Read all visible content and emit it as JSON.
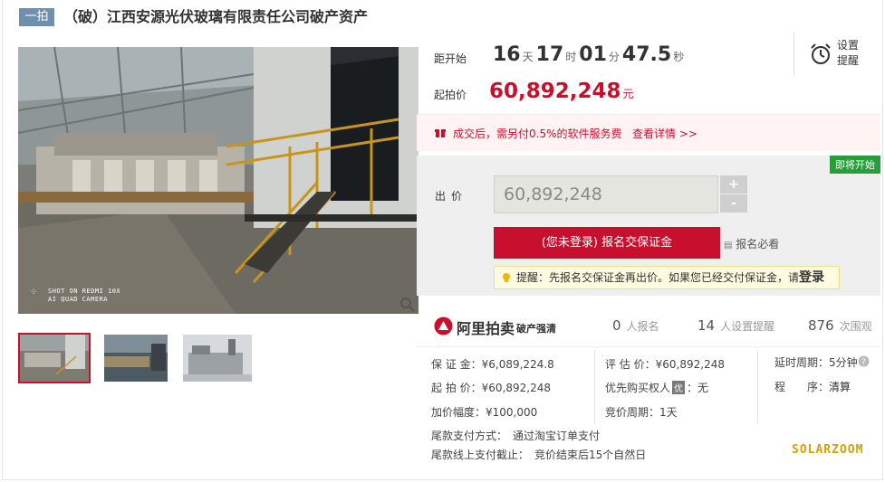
{
  "header": {
    "round_tag": "一拍",
    "title": "（破）江西安源光伏玻璃有限责任公司破产资产"
  },
  "gallery": {
    "camera_watermark_line1": "SHOT ON REDMI 10X",
    "camera_watermark_line2": "AI QUAD CAMERA",
    "zoom_icon": "magnifier-icon",
    "thumbnails": [
      "thumb-1",
      "thumb-2",
      "thumb-3"
    ]
  },
  "countdown": {
    "label": "距开始",
    "days": "16",
    "days_unit": "天",
    "hours": "17",
    "hours_unit": "时",
    "minutes": "01",
    "minutes_unit": "分",
    "seconds": "47.5",
    "seconds_unit": "秒"
  },
  "remind": {
    "label": "设置提醒",
    "icon": "alarm-clock-icon"
  },
  "start_price": {
    "label": "起拍价",
    "value": "60,892,248",
    "unit": "元"
  },
  "notice": {
    "icon": "gift-icon",
    "text": "成交后，需另付0.5%的软件服务费",
    "link": "查看详情 >>"
  },
  "bid": {
    "status_badge": "即将开始",
    "label": "出价",
    "value": "60,892,248",
    "plus": "+",
    "minus": "-",
    "enroll_button": "(您未登录) 报名交保证金",
    "must_read": "报名必看",
    "tip_prefix": "提醒：先报名交保证金再出价。如果您已经交付保证金，请",
    "tip_login": "登录"
  },
  "stats": {
    "brand": "阿里拍卖",
    "brand_sub": "破产强清",
    "enrolled_count": "0",
    "enrolled_label": "人报名",
    "reminders_count": "14",
    "reminders_label": "人设置提醒",
    "views_count": "876",
    "views_label": "次围观"
  },
  "details": {
    "deposit": "保 证 金：¥6,089,224.8",
    "start_price": "起 拍 价：¥60,892,248",
    "increment": "加价幅度：¥100,000",
    "appraisal": "评 估 价：¥60,892,248",
    "priority_label": "优先购买权人",
    "priority_badge": "优",
    "priority_value": "：无",
    "bid_cycle": "竞价周期：1天",
    "delay": "延时周期：5分钟",
    "procedure_label": "程　　序：",
    "procedure_value": "清算",
    "payment_method": "尾款支付方式：　通过淘宝订单支付",
    "payment_deadline": "尾款线上支付截止：　竞价结束后15个自然日"
  },
  "watermark": "SOLARZOOM",
  "colors": {
    "accent": "#c8102e",
    "tag": "#6f8fae",
    "badge": "#2a9d3a"
  }
}
